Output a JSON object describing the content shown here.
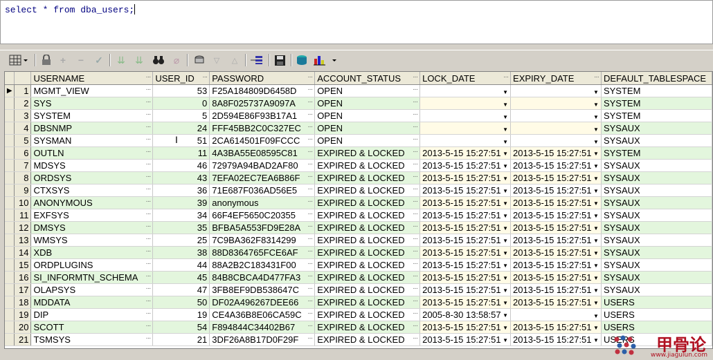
{
  "editor": {
    "sql": "select * from dba_users;"
  },
  "toolbar": {
    "icons": [
      "grid-icon",
      "lock-icon",
      "plus-icon",
      "minus-icon",
      "check-icon",
      "down-arrows-icon",
      "down-arrows2-icon",
      "binoculars-icon",
      "clear-icon",
      "export-icon",
      "triangle-down-icon",
      "triangle-up-icon",
      "query-icon",
      "save-icon",
      "database-icon",
      "chart-icon"
    ]
  },
  "columns": [
    "USERNAME",
    "USER_ID",
    "PASSWORD",
    "ACCOUNT_STATUS",
    "LOCK_DATE",
    "EXPIRY_DATE",
    "DEFAULT_TABLESPACE"
  ],
  "rows": [
    {
      "n": "1",
      "user": "MGMT_VIEW",
      "id": "53",
      "pwd": "F25A184809D6458D",
      "status": "OPEN",
      "lock": "",
      "exp": "",
      "ts": "SYSTEM"
    },
    {
      "n": "2",
      "user": "SYS",
      "id": "0",
      "pwd": "8A8F025737A9097A",
      "status": "OPEN",
      "lock": "",
      "exp": "",
      "ts": "SYSTEM"
    },
    {
      "n": "3",
      "user": "SYSTEM",
      "id": "5",
      "pwd": "2D594E86F93B17A1",
      "status": "OPEN",
      "lock": "",
      "exp": "",
      "ts": "SYSTEM"
    },
    {
      "n": "4",
      "user": "DBSNMP",
      "id": "24",
      "pwd": "FFF45BB2C0C327EC",
      "status": "OPEN",
      "lock": "",
      "exp": "",
      "ts": "SYSAUX"
    },
    {
      "n": "5",
      "user": "SYSMAN",
      "id": "51",
      "pwd": "2CA614501F09FCCC",
      "status": "OPEN",
      "lock": "",
      "exp": "",
      "ts": "SYSAUX"
    },
    {
      "n": "6",
      "user": "OUTLN",
      "id": "11",
      "pwd": "4A3BA55E08595C81",
      "status": "EXPIRED & LOCKED",
      "lock": "2013-5-15 15:27:51",
      "exp": "2013-5-15 15:27:51",
      "ts": "SYSTEM"
    },
    {
      "n": "7",
      "user": "MDSYS",
      "id": "46",
      "pwd": "72979A94BAD2AF80",
      "status": "EXPIRED & LOCKED",
      "lock": "2013-5-15 15:27:51",
      "exp": "2013-5-15 15:27:51",
      "ts": "SYSAUX"
    },
    {
      "n": "8",
      "user": "ORDSYS",
      "id": "43",
      "pwd": "7EFA02EC7EA6B86F",
      "status": "EXPIRED & LOCKED",
      "lock": "2013-5-15 15:27:51",
      "exp": "2013-5-15 15:27:51",
      "ts": "SYSAUX"
    },
    {
      "n": "9",
      "user": "CTXSYS",
      "id": "36",
      "pwd": "71E687F036AD56E5",
      "status": "EXPIRED & LOCKED",
      "lock": "2013-5-15 15:27:51",
      "exp": "2013-5-15 15:27:51",
      "ts": "SYSAUX"
    },
    {
      "n": "10",
      "user": "ANONYMOUS",
      "id": "39",
      "pwd": "anonymous",
      "status": "EXPIRED & LOCKED",
      "lock": "2013-5-15 15:27:51",
      "exp": "2013-5-15 15:27:51",
      "ts": "SYSAUX"
    },
    {
      "n": "11",
      "user": "EXFSYS",
      "id": "34",
      "pwd": "66F4EF5650C20355",
      "status": "EXPIRED & LOCKED",
      "lock": "2013-5-15 15:27:51",
      "exp": "2013-5-15 15:27:51",
      "ts": "SYSAUX"
    },
    {
      "n": "12",
      "user": "DMSYS",
      "id": "35",
      "pwd": "BFBA5A553FD9E28A",
      "status": "EXPIRED & LOCKED",
      "lock": "2013-5-15 15:27:51",
      "exp": "2013-5-15 15:27:51",
      "ts": "SYSAUX"
    },
    {
      "n": "13",
      "user": "WMSYS",
      "id": "25",
      "pwd": "7C9BA362F8314299",
      "status": "EXPIRED & LOCKED",
      "lock": "2013-5-15 15:27:51",
      "exp": "2013-5-15 15:27:51",
      "ts": "SYSAUX"
    },
    {
      "n": "14",
      "user": "XDB",
      "id": "38",
      "pwd": "88D8364765FCE6AF",
      "status": "EXPIRED & LOCKED",
      "lock": "2013-5-15 15:27:51",
      "exp": "2013-5-15 15:27:51",
      "ts": "SYSAUX"
    },
    {
      "n": "15",
      "user": "ORDPLUGINS",
      "id": "44",
      "pwd": "88A2B2C183431F00",
      "status": "EXPIRED & LOCKED",
      "lock": "2013-5-15 15:27:51",
      "exp": "2013-5-15 15:27:51",
      "ts": "SYSAUX"
    },
    {
      "n": "16",
      "user": "SI_INFORMTN_SCHEMA",
      "id": "45",
      "pwd": "84B8CBCA4D477FA3",
      "status": "EXPIRED & LOCKED",
      "lock": "2013-5-15 15:27:51",
      "exp": "2013-5-15 15:27:51",
      "ts": "SYSAUX"
    },
    {
      "n": "17",
      "user": "OLAPSYS",
      "id": "47",
      "pwd": "3FB8EF9DB538647C",
      "status": "EXPIRED & LOCKED",
      "lock": "2013-5-15 15:27:51",
      "exp": "2013-5-15 15:27:51",
      "ts": "SYSAUX"
    },
    {
      "n": "18",
      "user": "MDDATA",
      "id": "50",
      "pwd": "DF02A496267DEE66",
      "status": "EXPIRED & LOCKED",
      "lock": "2013-5-15 15:27:51",
      "exp": "2013-5-15 15:27:51",
      "ts": "USERS"
    },
    {
      "n": "19",
      "user": "DIP",
      "id": "19",
      "pwd": "CE4A36B8E06CA59C",
      "status": "EXPIRED & LOCKED",
      "lock": "2005-8-30 13:58:57",
      "exp": "",
      "ts": "USERS"
    },
    {
      "n": "20",
      "user": "SCOTT",
      "id": "54",
      "pwd": "F894844C34402B67",
      "status": "EXPIRED & LOCKED",
      "lock": "2013-5-15 15:27:51",
      "exp": "2013-5-15 15:27:51",
      "ts": "USERS"
    },
    {
      "n": "21",
      "user": "TSMSYS",
      "id": "21",
      "pwd": "3DF26A8B17D0F29F",
      "status": "EXPIRED & LOCKED",
      "lock": "2013-5-15 15:27:51",
      "exp": "2013-5-15 15:27:51",
      "ts": "USERS"
    }
  ],
  "watermark": {
    "title": "甲骨论",
    "url": "www.jiagulun.com"
  }
}
